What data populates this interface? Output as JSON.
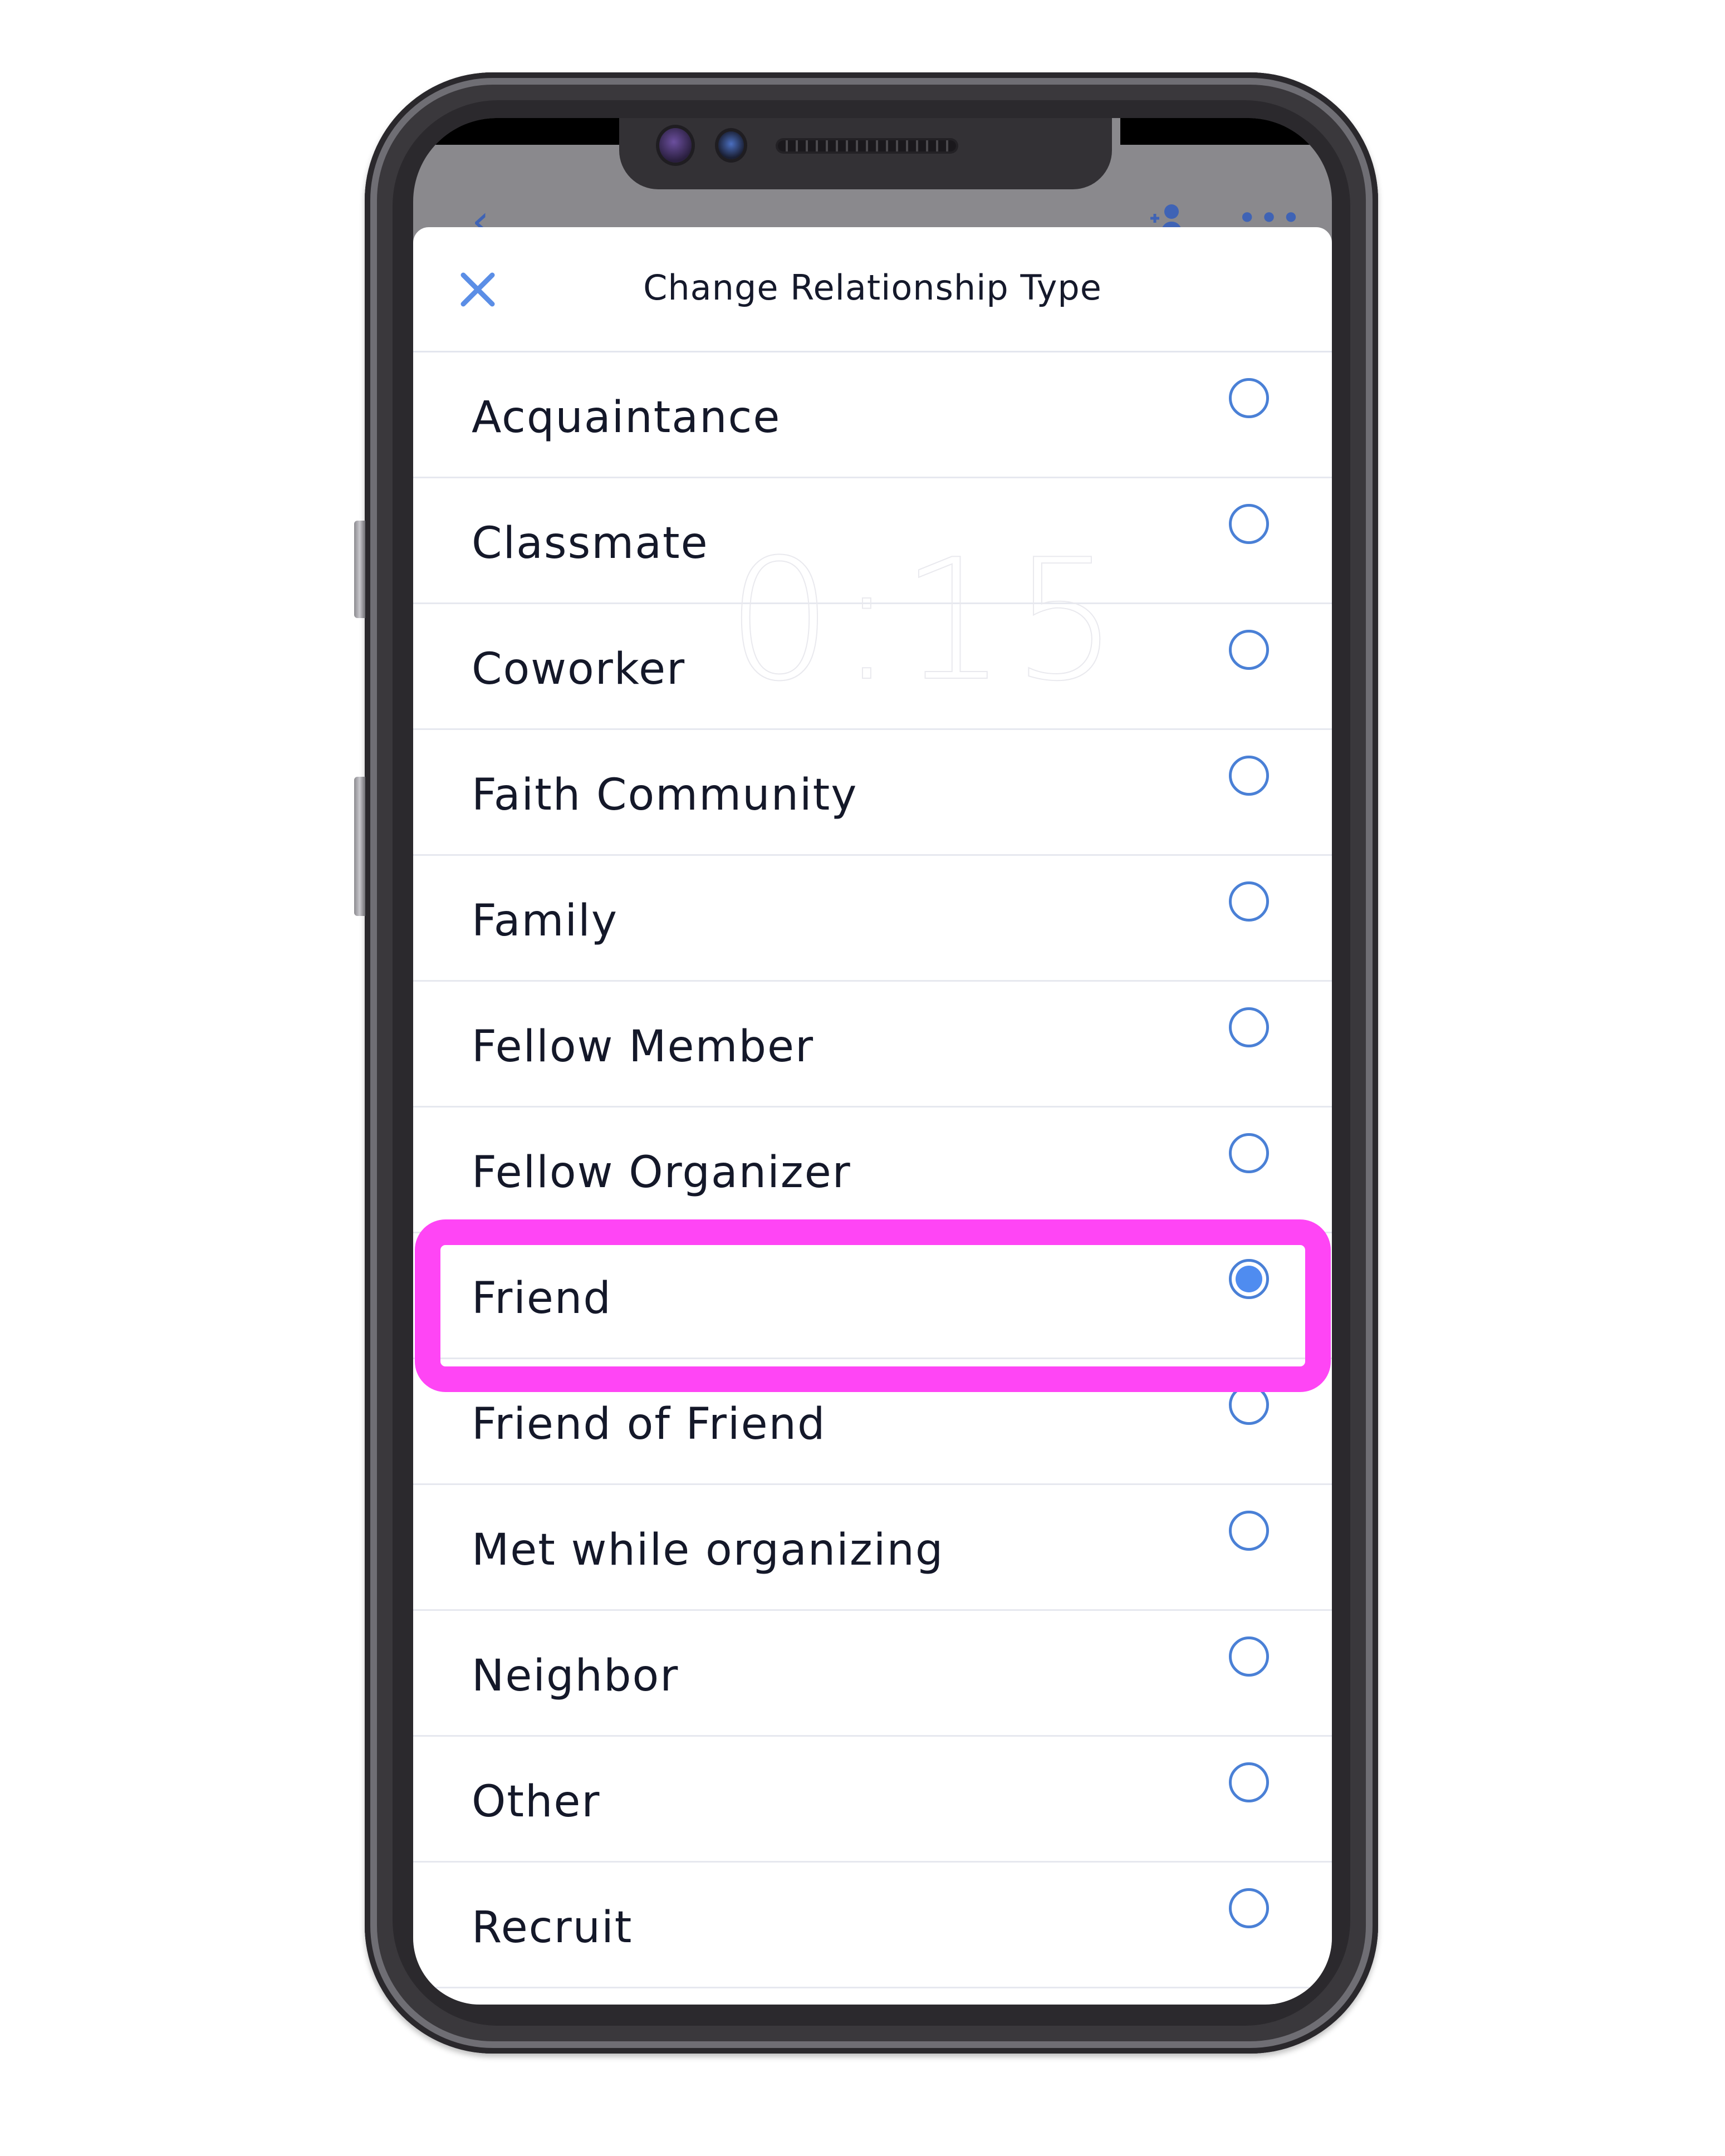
{
  "underlay": {
    "back_icon": "chevron-left-icon",
    "add_contact_icon": "add-person-icon",
    "more_icon": "more-horizontal-icon"
  },
  "sheet": {
    "title": "Change Relationship Type",
    "close_icon": "close-icon",
    "options": [
      {
        "label": "Acquaintance",
        "selected": false
      },
      {
        "label": "Classmate",
        "selected": false
      },
      {
        "label": "Coworker",
        "selected": false
      },
      {
        "label": "Faith Community",
        "selected": false
      },
      {
        "label": "Family",
        "selected": false
      },
      {
        "label": "Fellow Member",
        "selected": false
      },
      {
        "label": "Fellow Organizer",
        "selected": false
      },
      {
        "label": "Friend",
        "selected": true
      },
      {
        "label": "Friend of Friend",
        "selected": false
      },
      {
        "label": "Met while organizing",
        "selected": false
      },
      {
        "label": "Neighbor",
        "selected": false
      },
      {
        "label": "Other",
        "selected": false
      },
      {
        "label": "Recruit",
        "selected": false
      }
    ],
    "selected_value": "Friend"
  },
  "overlay": {
    "timer_watermark": "0:15",
    "highlight_target": "Friend"
  },
  "colors": {
    "accent": "#4a80d6",
    "radio_fill": "#4f8cf0",
    "highlight": "#ff45f5",
    "text": "#141829"
  }
}
